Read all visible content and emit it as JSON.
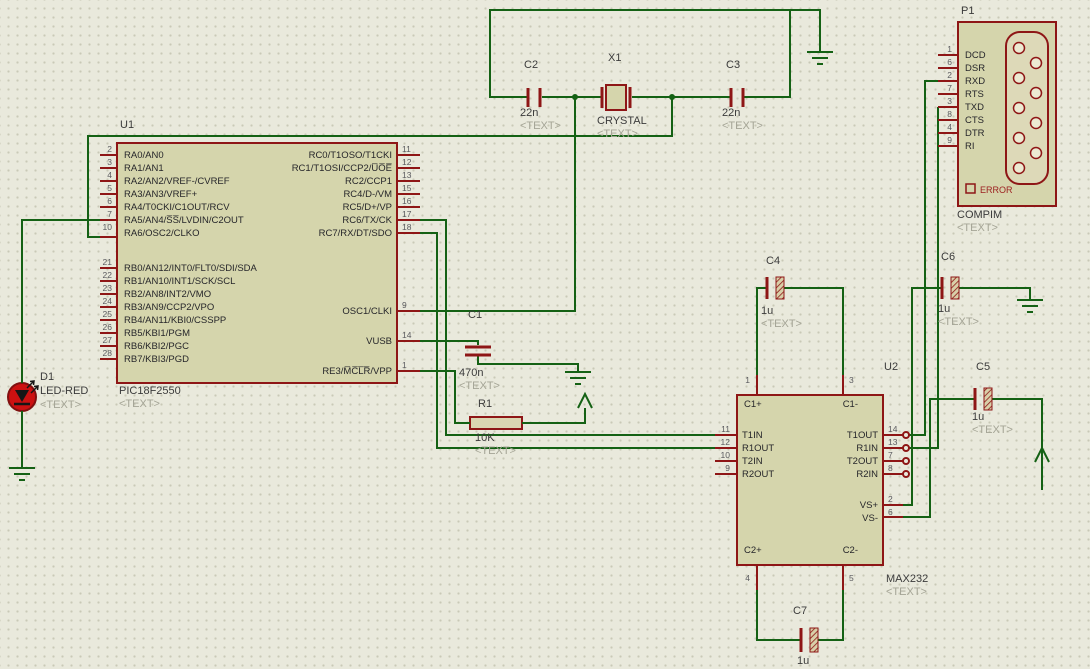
{
  "u1": {
    "ref": "U1",
    "value": "PIC18F2550",
    "placeholder": "<TEXT>",
    "left_a": [
      {
        "num": "2",
        "name": "RA0/AN0"
      },
      {
        "num": "3",
        "name": "RA1/AN1"
      },
      {
        "num": "4",
        "name": "RA2/AN2/VREF-/CVREF"
      },
      {
        "num": "5",
        "name": "RA3/AN3/VREF+"
      },
      {
        "num": "6",
        "name": "RA4/T0CKI/C1OUT/RCV"
      },
      {
        "num": "7",
        "name": "RA5/AN4/S̅S̅/LVDIN/C2OUT"
      },
      {
        "num": "10",
        "name": "RA6/OSC2/CLKO"
      }
    ],
    "left_b": [
      {
        "num": "21",
        "name": "RB0/AN12/INT0/FLT0/SDI/SDA"
      },
      {
        "num": "22",
        "name": "RB1/AN10/INT1/SCK/SCL"
      },
      {
        "num": "23",
        "name": "RB2/AN8/INT2/VMO"
      },
      {
        "num": "24",
        "name": "RB3/AN9/CCP2/VPO"
      },
      {
        "num": "25",
        "name": "RB4/AN11/KBI0/CSSPP"
      },
      {
        "num": "26",
        "name": "RB5/KBI1/PGM"
      },
      {
        "num": "27",
        "name": "RB6/KBI2/PGC"
      },
      {
        "num": "28",
        "name": "RB7/KBI3/PGD"
      }
    ],
    "right_a": [
      {
        "num": "11",
        "name": "RC0/T1OSO/T1CKI"
      },
      {
        "num": "12",
        "name": "RC1/T1OSI/CCP2/U̅O̅E̅"
      },
      {
        "num": "13",
        "name": "RC2/CCP1"
      },
      {
        "num": "15",
        "name": "RC4/D-/VM"
      },
      {
        "num": "16",
        "name": "RC5/D+/VP"
      },
      {
        "num": "17",
        "name": "RC6/TX/CK"
      },
      {
        "num": "18",
        "name": "RC7/RX/DT/SDO"
      }
    ],
    "right_b": [
      {
        "num": "9",
        "name": "OSC1/CLKI"
      },
      {
        "num": "14",
        "name": "VUSB"
      },
      {
        "num": "1",
        "name": "RE3/M̅C̅L̅R̅/VPP"
      }
    ]
  },
  "u2": {
    "ref": "U2",
    "value": "MAX232",
    "placeholder": "<TEXT>",
    "left": [
      {
        "num": "11",
        "name": "T1IN"
      },
      {
        "num": "12",
        "name": "R1OUT"
      },
      {
        "num": "10",
        "name": "T2IN"
      },
      {
        "num": "9",
        "name": "R2OUT"
      }
    ],
    "right": [
      {
        "num": "14",
        "name": "T1OUT"
      },
      {
        "num": "13",
        "name": "R1IN"
      },
      {
        "num": "7",
        "name": "T2OUT"
      },
      {
        "num": "8",
        "name": "R2IN"
      }
    ],
    "right2": [
      {
        "num": "2",
        "name": "VS+"
      },
      {
        "num": "6",
        "name": "VS-"
      }
    ],
    "top": [
      {
        "num": "1",
        "name": "C1+"
      },
      {
        "num": "3",
        "name": "C1-"
      }
    ],
    "bottom": [
      {
        "num": "4",
        "name": "C2+"
      },
      {
        "num": "5",
        "name": "C2-"
      }
    ]
  },
  "p1": {
    "ref": "P1",
    "value": "COMPIM",
    "placeholder": "<TEXT>",
    "error_label": "ERROR",
    "pins": [
      {
        "num": "1",
        "name": "DCD"
      },
      {
        "num": "6",
        "name": "DSR"
      },
      {
        "num": "2",
        "name": "RXD"
      },
      {
        "num": "7",
        "name": "RTS"
      },
      {
        "num": "3",
        "name": "TXD"
      },
      {
        "num": "8",
        "name": "CTS"
      },
      {
        "num": "4",
        "name": "DTR"
      },
      {
        "num": "9",
        "name": "RI"
      }
    ]
  },
  "parts": {
    "c1": {
      "ref": "C1",
      "value": "470n",
      "placeholder": "<TEXT>"
    },
    "c2": {
      "ref": "C2",
      "value": "22n",
      "placeholder": "<TEXT>"
    },
    "c3": {
      "ref": "C3",
      "value": "22n",
      "placeholder": "<TEXT>"
    },
    "c4": {
      "ref": "C4",
      "value": "1u",
      "placeholder": "<TEXT>"
    },
    "c5": {
      "ref": "C5",
      "value": "1u",
      "placeholder": "<TEXT>"
    },
    "c6": {
      "ref": "C6",
      "value": "1u",
      "placeholder": "<TEXT>"
    },
    "c7": {
      "ref": "C7",
      "value": "1u"
    },
    "x1": {
      "ref": "X1",
      "value": "CRYSTAL",
      "placeholder": "<TEXT>"
    },
    "r1": {
      "ref": "R1",
      "value": "10K",
      "placeholder": "<TEXT>"
    },
    "d1": {
      "ref": "D1",
      "value": "LED-RED",
      "placeholder": "<TEXT>"
    }
  },
  "colors": {
    "wire": "#146114",
    "component_outline": "#8e1616",
    "component_fill": "#d5d5ac",
    "background": "#e9e9dc",
    "placeholder_text": "#a5a596",
    "label_text": "#3b3b3b",
    "led_red": "#cc1111"
  }
}
